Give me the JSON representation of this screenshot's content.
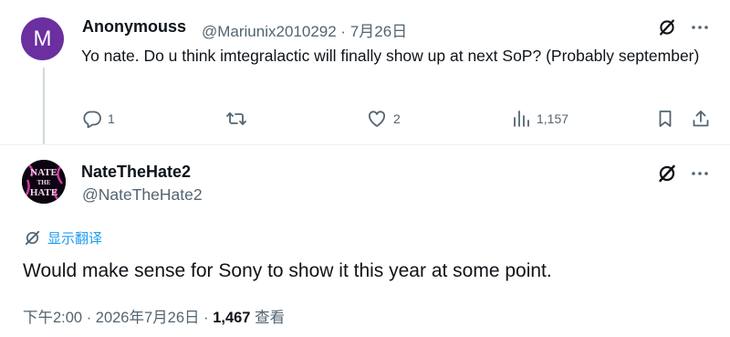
{
  "reply": {
    "avatar_letter": "M",
    "name": "Anonymouss",
    "handle": "@Mariunix2010292",
    "separator": "·",
    "date": "7月26日",
    "text": "Yo nate. Do u think imtegralactic will finally show up at next SoP? (Probably september)",
    "actions": {
      "reply_count": "1",
      "retweet_count": "",
      "like_count": "2",
      "view_count": "1,157"
    }
  },
  "main": {
    "name": "NateTheHate2",
    "handle": "@NateTheHate2",
    "avatar_text_top": "NATE",
    "avatar_text_mid": "THE",
    "avatar_text_bottom": "HATE",
    "translate_label": "显示翻译",
    "text": "Would make sense for Sony to show it this year at some point.",
    "timestamp": "下午2:00 · 2026年7月26日 · ",
    "views": "1,467",
    "views_label": " 查看"
  },
  "colors": {
    "accent": "#1d9bf0",
    "text_primary": "#0f1419",
    "text_secondary": "#536471",
    "avatar_bg": "#6b2fa0",
    "avatar_art": "#d438a8"
  },
  "icons": {
    "grok": "grok-icon",
    "more": "more-icon",
    "reply": "reply-icon",
    "retweet": "retweet-icon",
    "like": "heart-icon",
    "views": "views-icon",
    "bookmark": "bookmark-icon",
    "share": "share-icon",
    "translate": "translate-icon"
  }
}
